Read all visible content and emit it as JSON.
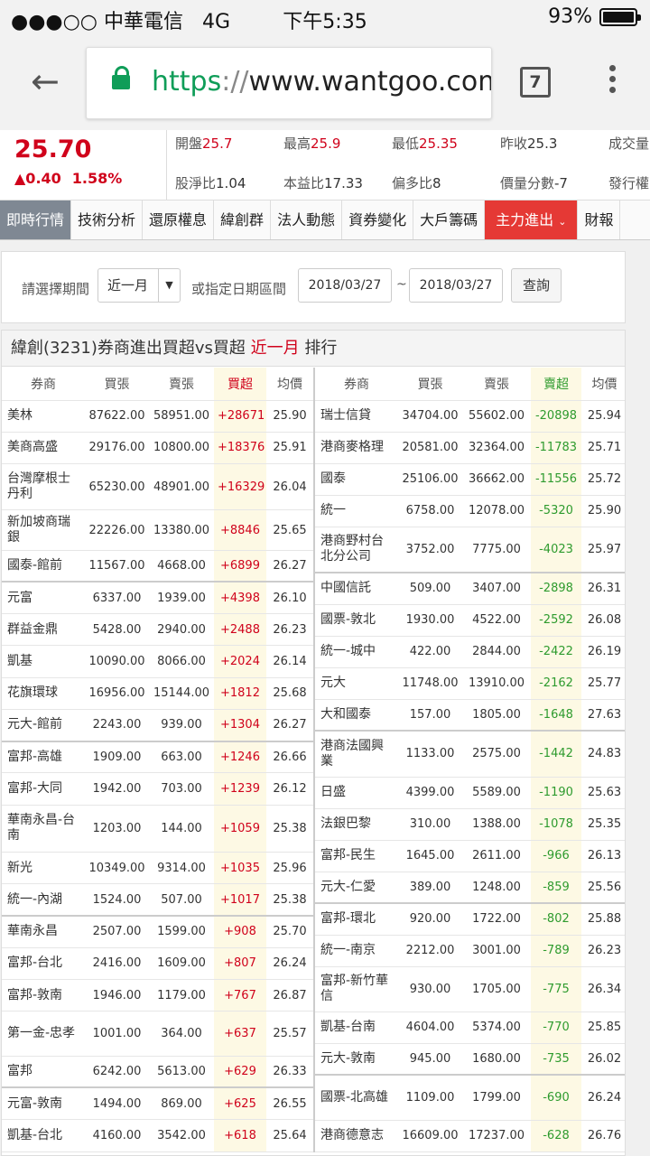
{
  "status": {
    "carrier": "●●●○○ 中華電信",
    "network": "4G",
    "time": "下午5:35",
    "battery": "93%"
  },
  "browser": {
    "url_proto": "https",
    "url_sep": "://",
    "url_host": "www.wantgoo.com/",
    "tab_count": "7"
  },
  "quote": {
    "price": "25.70",
    "change": "▲0.40",
    "change_pct": "1.58%",
    "open_label": "開盤",
    "open": "25.7",
    "high_label": "最高",
    "high": "25.9",
    "low_label": "最低",
    "low": "25.35",
    "prev_label": "昨收",
    "prev": "25.3",
    "volume_label": "成交量",
    "pb_label": "股淨比",
    "pb": "1.04",
    "pe_label": "本益比",
    "pe": "17.33",
    "bull_label": "偏多比",
    "bull": "8",
    "pvs_label": "價量分數",
    "pvs": "-7",
    "shares_label": "發行權"
  },
  "nav": [
    "即時行情",
    "技術分析",
    "還原權息",
    "緯創群",
    "法人動態",
    "資券變化",
    "大戶籌碼",
    "主力進出",
    "財報"
  ],
  "filter": {
    "period_label": "請選擇期間",
    "period_value": "近一月",
    "range_label": "或指定日期區間",
    "start_date": "2018/03/27",
    "tilde": "~",
    "end_date": "2018/03/27",
    "query_label": "查詢"
  },
  "panel": {
    "title": "緯創(3231)券商進出買超vs買超",
    "title_period": "近一月",
    "title_suffix": "排行"
  },
  "buy_table": {
    "headers": [
      "券商",
      "買張",
      "賣張",
      "買超",
      "均價"
    ],
    "rows": [
      [
        "美林",
        "87622.00",
        "58951.00",
        "+28671",
        "25.90"
      ],
      [
        "美商高盛",
        "29176.00",
        "10800.00",
        "+18376",
        "25.91"
      ],
      [
        "台灣摩根士丹利",
        "65230.00",
        "48901.00",
        "+16329",
        "26.04"
      ],
      [
        "新加坡商瑞銀",
        "22226.00",
        "13380.00",
        "+8846",
        "25.65"
      ],
      [
        "國泰-館前",
        "11567.00",
        "4668.00",
        "+6899",
        "26.27"
      ],
      [
        "元富",
        "6337.00",
        "1939.00",
        "+4398",
        "26.10"
      ],
      [
        "群益金鼎",
        "5428.00",
        "2940.00",
        "+2488",
        "26.23"
      ],
      [
        "凱基",
        "10090.00",
        "8066.00",
        "+2024",
        "26.14"
      ],
      [
        "花旗環球",
        "16956.00",
        "15144.00",
        "+1812",
        "25.68"
      ],
      [
        "元大-館前",
        "2243.00",
        "939.00",
        "+1304",
        "26.27"
      ],
      [
        "富邦-高雄",
        "1909.00",
        "663.00",
        "+1246",
        "26.66"
      ],
      [
        "富邦-大同",
        "1942.00",
        "703.00",
        "+1239",
        "26.12"
      ],
      [
        "華南永昌-台南",
        "1203.00",
        "144.00",
        "+1059",
        "25.38"
      ],
      [
        "新光",
        "10349.00",
        "9314.00",
        "+1035",
        "25.96"
      ],
      [
        "統一-內湖",
        "1524.00",
        "507.00",
        "+1017",
        "25.38"
      ],
      [
        "華南永昌",
        "2507.00",
        "1599.00",
        "+908",
        "25.70"
      ],
      [
        "富邦-台北",
        "2416.00",
        "1609.00",
        "+807",
        "26.24"
      ],
      [
        "富邦-敦南",
        "1946.00",
        "1179.00",
        "+767",
        "26.87"
      ],
      [
        "第一金-忠孝",
        "1001.00",
        "364.00",
        "+637",
        "25.57"
      ],
      [
        "富邦",
        "6242.00",
        "5613.00",
        "+629",
        "26.33"
      ],
      [
        "元富-敦南",
        "1494.00",
        "869.00",
        "+625",
        "26.55"
      ],
      [
        "凱基-台北",
        "4160.00",
        "3542.00",
        "+618",
        "25.64"
      ]
    ]
  },
  "sell_table": {
    "headers": [
      "券商",
      "買張",
      "賣張",
      "賣超",
      "均價"
    ],
    "rows": [
      [
        "瑞士信貸",
        "34704.00",
        "55602.00",
        "-20898",
        "25.94"
      ],
      [
        "港商麥格理",
        "20581.00",
        "32364.00",
        "-11783",
        "25.71"
      ],
      [
        "國泰",
        "25106.00",
        "36662.00",
        "-11556",
        "25.72"
      ],
      [
        "統一",
        "6758.00",
        "12078.00",
        "-5320",
        "25.90"
      ],
      [
        "港商野村台北分公司",
        "3752.00",
        "7775.00",
        "-4023",
        "25.97"
      ],
      [
        "中國信託",
        "509.00",
        "3407.00",
        "-2898",
        "26.31"
      ],
      [
        "國票-敦北",
        "1930.00",
        "4522.00",
        "-2592",
        "26.08"
      ],
      [
        "統一-城中",
        "422.00",
        "2844.00",
        "-2422",
        "26.19"
      ],
      [
        "元大",
        "11748.00",
        "13910.00",
        "-2162",
        "25.77"
      ],
      [
        "大和國泰",
        "157.00",
        "1805.00",
        "-1648",
        "27.63"
      ],
      [
        "港商法國興業",
        "1133.00",
        "2575.00",
        "-1442",
        "24.83"
      ],
      [
        "日盛",
        "4399.00",
        "5589.00",
        "-1190",
        "25.63"
      ],
      [
        "法銀巴黎",
        "310.00",
        "1388.00",
        "-1078",
        "25.35"
      ],
      [
        "富邦-民生",
        "1645.00",
        "2611.00",
        "-966",
        "26.13"
      ],
      [
        "元大-仁愛",
        "389.00",
        "1248.00",
        "-859",
        "25.56"
      ],
      [
        "富邦-環北",
        "920.00",
        "1722.00",
        "-802",
        "25.88"
      ],
      [
        "統一-南京",
        "2212.00",
        "3001.00",
        "-789",
        "26.23"
      ],
      [
        "富邦-新竹華信",
        "930.00",
        "1705.00",
        "-775",
        "26.34"
      ],
      [
        "凱基-台南",
        "4604.00",
        "5374.00",
        "-770",
        "25.85"
      ],
      [
        "元大-敦南",
        "945.00",
        "1680.00",
        "-735",
        "26.02"
      ],
      [
        "國票-北高雄",
        "1109.00",
        "1799.00",
        "-690",
        "26.24"
      ],
      [
        "港商德意志",
        "16609.00",
        "17237.00",
        "-628",
        "26.76"
      ]
    ]
  }
}
